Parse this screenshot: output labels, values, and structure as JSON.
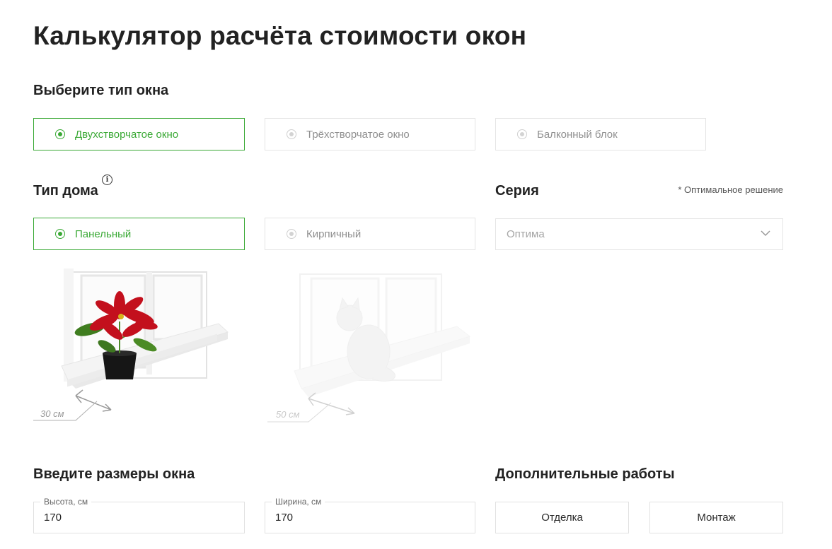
{
  "title": "Калькулятор расчёта стоимости окон",
  "window_type": {
    "heading": "Выберите тип окна",
    "options": [
      "Двухстворчатое окно",
      "Трёхстворчатое окно",
      "Балконный блок"
    ],
    "selected": 0
  },
  "house_type": {
    "heading": "Тип дома",
    "options": [
      "Панельный",
      "Кирпичный"
    ],
    "selected": 0,
    "illustrations": [
      {
        "subject": "poinsettia-plant",
        "sill_depth": "30 см",
        "active": true
      },
      {
        "subject": "cat",
        "sill_depth": "50 см",
        "active": false
      }
    ]
  },
  "series": {
    "heading": "Серия",
    "note": "* Оптимальное решение",
    "selected_value": "Оптима"
  },
  "dimensions": {
    "heading": "Введите размеры окна",
    "height_label": "Высота, см",
    "height_value": "170",
    "width_label": "Ширина, см",
    "width_value": "170"
  },
  "extra_works": {
    "heading": "Дополнительные работы",
    "buttons": [
      "Отделка",
      "Монтаж"
    ]
  },
  "colors": {
    "accent": "#3aa935",
    "border": "#e4e4e4",
    "muted_text": "#8f8f8f"
  },
  "icons": [
    "radio-selected-icon",
    "radio-icon",
    "info-icon",
    "chevron-down-icon",
    "double-arrow-icon"
  ]
}
